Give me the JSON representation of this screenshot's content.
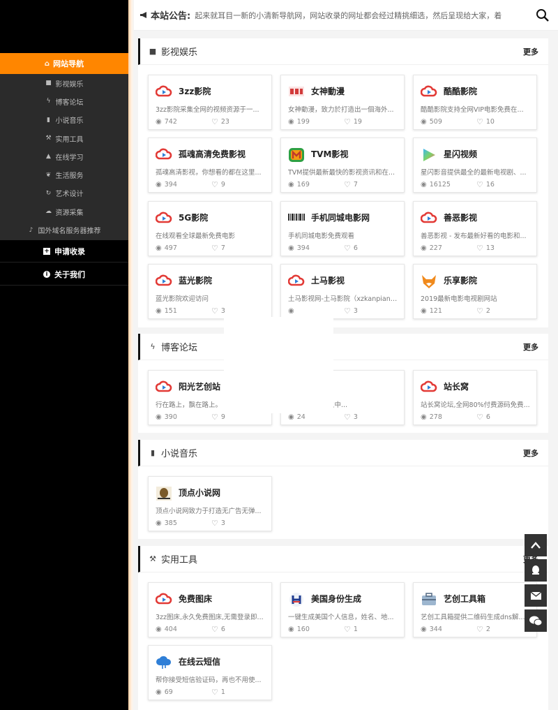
{
  "sidebar": {
    "active": {
      "label": "网站导航",
      "icon": "home-icon"
    },
    "subitems": [
      {
        "label": "影视娱乐",
        "icon": "video-camera-icon"
      },
      {
        "label": "博客论坛",
        "icon": "bolt-icon"
      },
      {
        "label": "小说音乐",
        "icon": "book-icon"
      },
      {
        "label": "实用工具",
        "icon": "hammer-icon"
      },
      {
        "label": "在线学习",
        "icon": "graduation-cap-icon"
      },
      {
        "label": "生活服务",
        "icon": "leaf-icon"
      },
      {
        "label": "艺术设计",
        "icon": "refresh-icon"
      },
      {
        "label": "资源采集",
        "icon": "cloud-icon"
      },
      {
        "label": "国外域名服务器推荐",
        "icon": "bell-icon"
      }
    ],
    "main": [
      {
        "label": "申请收录",
        "icon": "plus-square-icon"
      },
      {
        "label": "关于我们",
        "icon": "info-circle-icon"
      }
    ]
  },
  "notice": {
    "label": "本站公告:",
    "icon": "bullhorn-icon",
    "text": "起来就耳目一新的小清新导航网，网站收录的网址都会经过精挑细选，然后呈现给大家，着"
  },
  "sections": [
    {
      "title": "影视娱乐",
      "icon": "video-camera-icon",
      "more": "更多",
      "cards": [
        {
          "name": "3zz影院",
          "desc": "3zz影院采集全网的视频资源于一...",
          "views": "742",
          "likes": "23",
          "logo": "play-cloud-logo"
        },
        {
          "name": "女神動漫",
          "desc": "女神動漫，致力於打造出一個海外...",
          "views": "199",
          "likes": "19",
          "logo": "nvshen-logo"
        },
        {
          "name": "酷酷影院",
          "desc": "酷酷影院支持全网VIP电影免费在...",
          "views": "509",
          "likes": "10",
          "logo": "play-cloud-logo"
        },
        {
          "name": "孤魂高清免费影视",
          "desc": "孤魂高清影视，你想看的都在这里...",
          "views": "394",
          "likes": "9",
          "logo": "play-cloud-logo"
        },
        {
          "name": "TVM影视",
          "desc": "TVM提供最新最快的影视资讯和在...",
          "views": "169",
          "likes": "7",
          "logo": "tvm-logo"
        },
        {
          "name": "星闪视频",
          "desc": "星闪影音提供最全的最新电视剧、...",
          "views": "16125",
          "likes": "16",
          "logo": "play-gradient-logo"
        },
        {
          "name": "5G影院",
          "desc": "在线观看全球最新免费电影",
          "views": "497",
          "likes": "7",
          "logo": "play-cloud-logo"
        },
        {
          "name": "手机同城电影网",
          "desc": "手机同城电影免费观看",
          "views": "394",
          "likes": "6",
          "logo": "barcode-logo"
        },
        {
          "name": "善恶影视",
          "desc": "善恶影视 - 发布最新好看的电影和...",
          "views": "227",
          "likes": "13",
          "logo": "play-cloud-logo"
        },
        {
          "name": "蓝光影院",
          "desc": "蓝光影院欢迎访问",
          "views": "151",
          "likes": "3",
          "logo": "play-cloud-logo"
        },
        {
          "name": "土马影视",
          "desc": "土马影视网-土马影院（xzkanpian....",
          "views": "",
          "likes": "3",
          "logo": "play-cloud-logo"
        },
        {
          "name": "乐享影院",
          "desc": "2019最新电影电视剧网站",
          "views": "121",
          "likes": "2",
          "logo": "fox-logo"
        }
      ]
    },
    {
      "title": "博客论坛",
      "icon": "bolt-icon",
      "more": "更多",
      "cards": [
        {
          "name": "阳光艺创站",
          "desc": "行在路上，飘在路上。",
          "views": "390",
          "likes": "9",
          "logo": "play-cloud-logo"
        },
        {
          "name": "",
          "desc": "小站。于乱世之中...",
          "views": "24",
          "likes": "3",
          "logo": ""
        },
        {
          "name": "站长窝",
          "desc": "站长窝论坛,全网80%付费源码免费...",
          "views": "278",
          "likes": "6",
          "logo": "play-cloud-logo"
        }
      ]
    },
    {
      "title": "小说音乐",
      "icon": "book-icon",
      "more": "更多",
      "cards": [
        {
          "name": "顶点小说网",
          "desc": "顶点小说网致力于打造无广告无弹...",
          "views": "385",
          "likes": "3",
          "logo": "dingdian-logo"
        }
      ]
    },
    {
      "title": "实用工具",
      "icon": "hammer-icon",
      "more": "更多",
      "cards": [
        {
          "name": "免费图床",
          "desc": "3zz图床,永久免费图床,无需登录即...",
          "views": "404",
          "likes": "6",
          "logo": "play-cloud-logo"
        },
        {
          "name": "美国身份生成",
          "desc": "一键生成美国个人信息，姓名、地...",
          "views": "160",
          "likes": "1",
          "logo": "h-logo"
        },
        {
          "name": "艺创工具箱",
          "desc": "艺创工具箱提供二维码生成dns解...",
          "views": "344",
          "likes": "2",
          "logo": "toolbox-logo"
        },
        {
          "name": "在线云短信",
          "desc": "帮你接受短信验证码，再也不用使...",
          "views": "69",
          "likes": "1",
          "logo": "cloud-sms-logo"
        }
      ]
    }
  ],
  "float_buttons": [
    {
      "icon": "arrow-up-icon"
    },
    {
      "icon": "qq-icon"
    },
    {
      "icon": "envelope-icon"
    },
    {
      "icon": "wechat-icon"
    }
  ],
  "colors": {
    "accent": "#ff8600",
    "sidebar": "#000000",
    "sidebar_sub": "#2b2b2b"
  }
}
